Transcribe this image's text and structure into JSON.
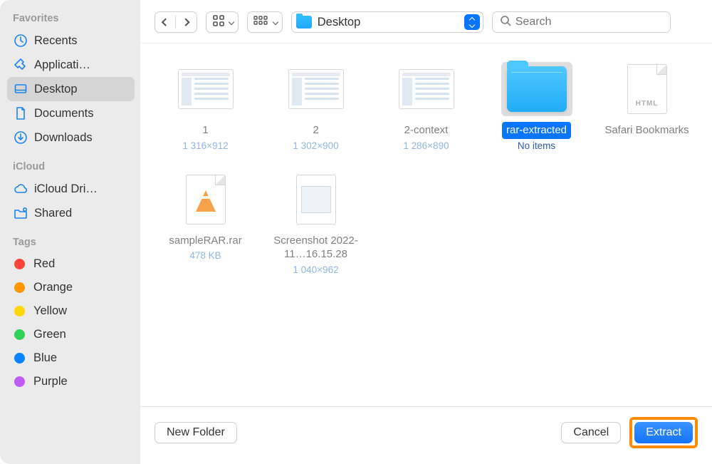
{
  "sidebar": {
    "sections": {
      "favorites_title": "Favorites",
      "icloud_title": "iCloud",
      "tags_title": "Tags"
    },
    "favorites": [
      {
        "label": "Recents",
        "icon": "clock-icon",
        "selected": false
      },
      {
        "label": "Applicati…",
        "icon": "app-icon",
        "selected": false
      },
      {
        "label": "Desktop",
        "icon": "desktop-icon",
        "selected": true
      },
      {
        "label": "Documents",
        "icon": "document-icon",
        "selected": false
      },
      {
        "label": "Downloads",
        "icon": "download-icon",
        "selected": false
      }
    ],
    "icloud": [
      {
        "label": "iCloud Dri…",
        "icon": "cloud-icon"
      },
      {
        "label": "Shared",
        "icon": "shared-folder-icon"
      }
    ],
    "tags": [
      {
        "label": "Red",
        "color": "#ff453a"
      },
      {
        "label": "Orange",
        "color": "#ff9500"
      },
      {
        "label": "Yellow",
        "color": "#ffd60a"
      },
      {
        "label": "Green",
        "color": "#30d158"
      },
      {
        "label": "Blue",
        "color": "#0a84ff"
      },
      {
        "label": "Purple",
        "color": "#bf5af2"
      }
    ]
  },
  "toolbar": {
    "location": "Desktop",
    "search_placeholder": "Search"
  },
  "files": [
    {
      "name": "1",
      "sub": "1 316×912",
      "kind": "window-thumb",
      "selected": false
    },
    {
      "name": "2",
      "sub": "1 302×900",
      "kind": "window-thumb",
      "selected": false
    },
    {
      "name": "2-context",
      "sub": "1 286×890",
      "kind": "window-thumb",
      "selected": false
    },
    {
      "name": "rar-extracted",
      "sub": "No items",
      "kind": "folder",
      "selected": true
    },
    {
      "name": "Safari Bookmarks",
      "sub": "",
      "kind": "html-file",
      "selected": false,
      "ext": "HTML"
    },
    {
      "name": "sampleRAR.rar",
      "sub": "478 KB",
      "kind": "rar-file",
      "selected": false
    },
    {
      "name": "Screenshot 2022-11…16.15.28",
      "sub": "1 040×962",
      "kind": "screenshot",
      "selected": false
    }
  ],
  "actions": {
    "new_folder": "New Folder",
    "cancel": "Cancel",
    "extract": "Extract"
  }
}
